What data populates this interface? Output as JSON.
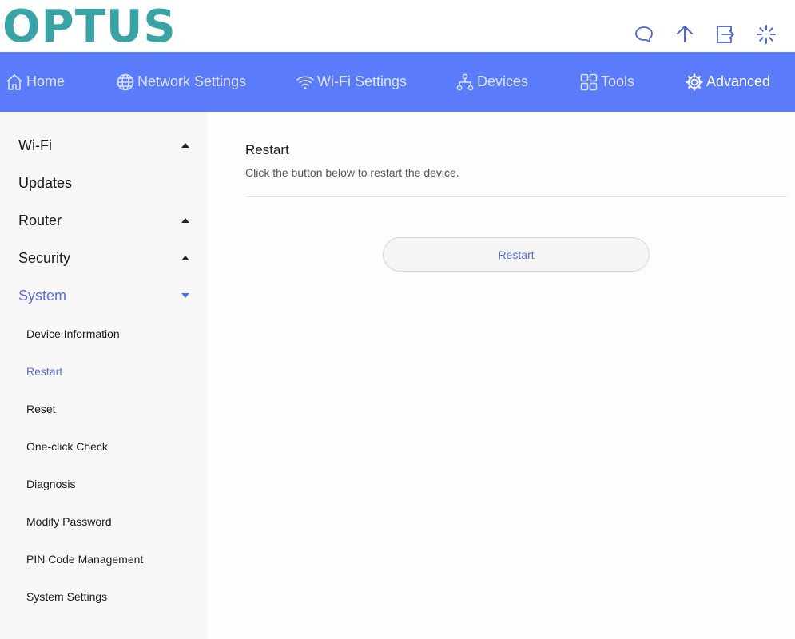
{
  "brand": {
    "logo_text": "OPTUS",
    "color": "#3aa3a5"
  },
  "header_icons": [
    "chat-icon",
    "upload-arrow-icon",
    "logout-icon",
    "loading-spinner-icon"
  ],
  "nav": {
    "background": "#5a7cfa",
    "items": [
      {
        "label": "Home",
        "icon": "home-icon"
      },
      {
        "label": "Network Settings",
        "icon": "globe-icon"
      },
      {
        "label": "Wi-Fi Settings",
        "icon": "wifi-icon"
      },
      {
        "label": "Devices",
        "icon": "network-tree-icon"
      },
      {
        "label": "Tools",
        "icon": "grid-icon"
      },
      {
        "label": "Advanced",
        "icon": "gear-icon",
        "active": true
      }
    ]
  },
  "sidebar": {
    "sections": [
      {
        "label": "Wi-Fi",
        "caret": "up"
      },
      {
        "label": "Updates"
      },
      {
        "label": "Router",
        "caret": "up"
      },
      {
        "label": "Security",
        "caret": "up"
      },
      {
        "label": "System",
        "caret": "down",
        "active": true
      }
    ],
    "system_items": [
      {
        "label": "Device Information"
      },
      {
        "label": "Restart",
        "active": true
      },
      {
        "label": "Reset"
      },
      {
        "label": "One-click Check"
      },
      {
        "label": "Diagnosis"
      },
      {
        "label": "Modify Password"
      },
      {
        "label": "PIN Code Management"
      },
      {
        "label": "System Settings"
      }
    ]
  },
  "main": {
    "title": "Restart",
    "description": "Click the button below to restart the device.",
    "button_label": "Restart"
  }
}
